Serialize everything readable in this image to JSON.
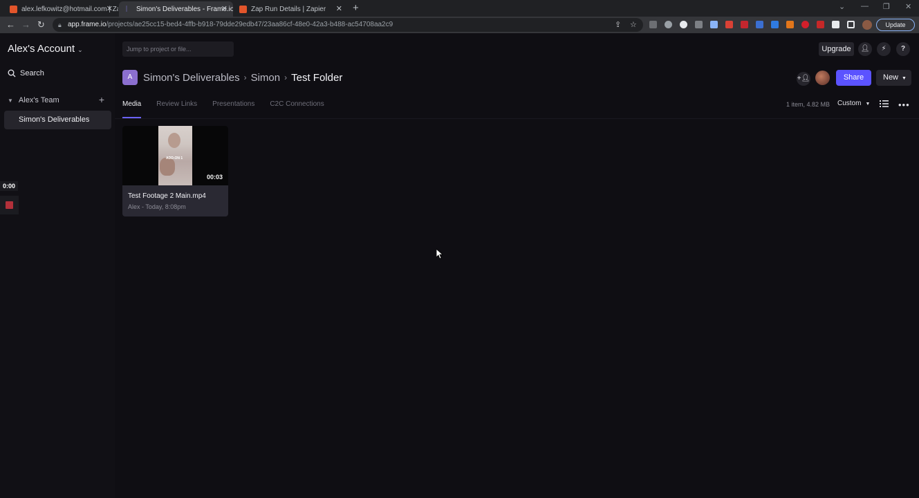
{
  "browser": {
    "tabs": [
      {
        "title": "alex.lefkowitz@hotmail.com | Zap",
        "favicon_color": "#e2552b"
      },
      {
        "title": "Simon's Deliverables - Frame.io",
        "favicon_color": "#6b62ff"
      },
      {
        "title": "Zap Run Details | Zapier",
        "favicon_color": "#e2552b"
      }
    ],
    "url_host": "app.frame.io",
    "url_path": "/projects/ae25cc15-bed4-4ffb-b918-79dde29edb47/23aa86cf-48e0-42a3-b488-ac54708aa2c9",
    "update_label": "Update"
  },
  "sidebar": {
    "account_name": "Alex's Account",
    "search_label": "Search",
    "team_name": "Alex's Team",
    "projects": [
      {
        "label": "Simon's Deliverables"
      }
    ]
  },
  "recorder": {
    "time": "0:00"
  },
  "header": {
    "jump_placeholder": "Jump to project or file...",
    "upgrade_label": "Upgrade"
  },
  "breadcrumb": {
    "badge": "A",
    "items": [
      "Simon's Deliverables",
      "Simon",
      "Test Folder"
    ]
  },
  "actions": {
    "share_label": "Share",
    "new_label": "New"
  },
  "tabs": [
    "Media",
    "Review Links",
    "Presentations",
    "C2C Connections"
  ],
  "summary": {
    "count_text": "1 item, 4.82 MB",
    "sort_label": "Custom"
  },
  "assets": [
    {
      "name": "Test Footage 2 Main.mp4",
      "meta": "Alex - Today, 8:08pm",
      "duration": "00:03",
      "thumb_caption": "ADD-ON 1"
    }
  ],
  "colors": {
    "accent": "#5b53ff",
    "background": "#0f0e13",
    "sidebar": "#111015",
    "card": "#2a2933"
  }
}
